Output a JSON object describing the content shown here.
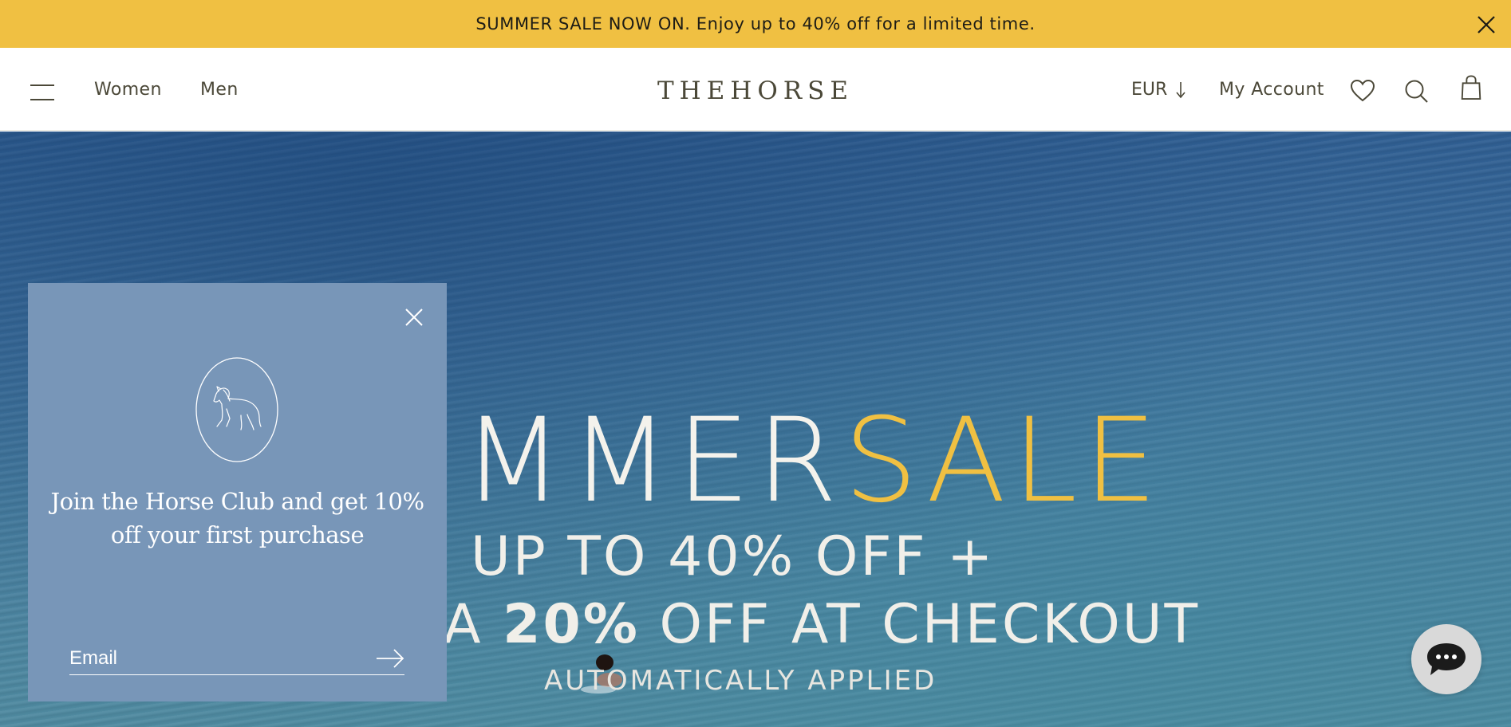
{
  "announcement": {
    "text": "SUMMER SALE NOW ON. Enjoy up to 40% off for a limited time.",
    "close_icon": "close-icon",
    "background": "#f0c042"
  },
  "header": {
    "menu_icon": "hamburger-icon",
    "nav": [
      {
        "label": "Women"
      },
      {
        "label": "Men"
      }
    ],
    "logo": "THEHORSE",
    "currency": {
      "label": "EUR",
      "icon": "arrow-down-icon"
    },
    "account_label": "My Account",
    "icons": [
      "heart-icon",
      "search-icon",
      "shopping-bag-icon"
    ]
  },
  "hero": {
    "title_white": "MMER",
    "title_yellow": "SALE",
    "line1": "UP TO 40% OFF +",
    "line2_prefix": "A ",
    "line2_bold": "20%",
    "line2_suffix": " OFF AT CHECKOUT",
    "line3": "AUTOMATICALLY APPLIED",
    "accent_color": "#f0c042"
  },
  "popup": {
    "close_icon": "close-icon",
    "logo_icon": "horse-icon",
    "heading_line1": "Join the Horse Club and get 10%",
    "heading_line2": "off your first purchase",
    "email_placeholder": "Email",
    "submit_icon": "arrow-right-icon",
    "background": "#7896b8"
  },
  "chat": {
    "icon": "chat-bubble-icon"
  }
}
